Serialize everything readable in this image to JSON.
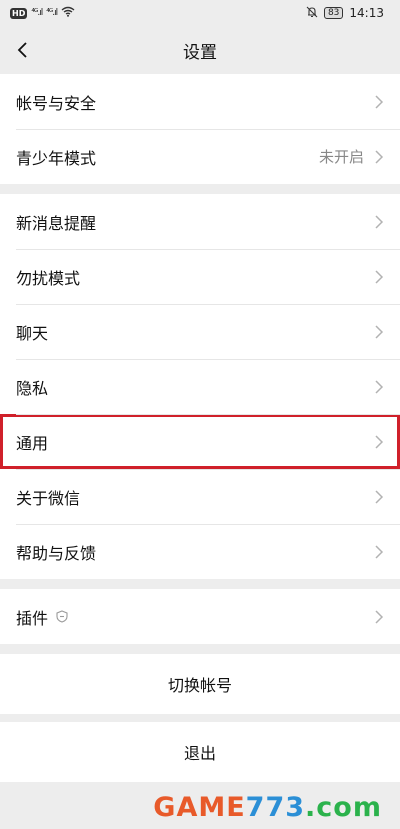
{
  "status_bar": {
    "hd": "HD",
    "signal1": "⁴ᴳ.ıl",
    "signal2": "⁴ᴳ.ıl",
    "battery": "83",
    "time": "14:13"
  },
  "navbar": {
    "title": "设置",
    "back_icon": "chevron-left-icon"
  },
  "group1": [
    {
      "label": "帐号与安全",
      "value": ""
    },
    {
      "label": "青少年模式",
      "value": "未开启"
    }
  ],
  "group2": [
    {
      "label": "新消息提醒"
    },
    {
      "label": "勿扰模式"
    },
    {
      "label": "聊天"
    },
    {
      "label": "隐私"
    },
    {
      "label": "通用",
      "highlighted": true
    },
    {
      "label": "关于微信"
    },
    {
      "label": "帮助与反馈"
    }
  ],
  "group3": [
    {
      "label": "插件",
      "icon": "shield-icon"
    }
  ],
  "switch_account": "切换帐号",
  "logout": "退出",
  "watermark": {
    "part1": "GAME",
    "part2": "773",
    "part3": ".com"
  },
  "colors": {
    "highlight": "#d0202a",
    "background": "#ededed",
    "value_gray": "#888888"
  }
}
